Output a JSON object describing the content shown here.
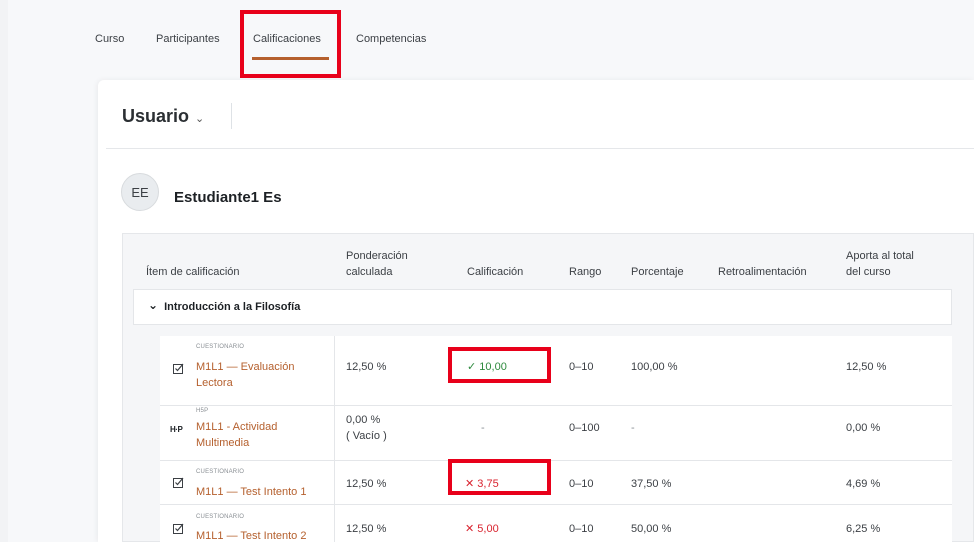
{
  "nav": {
    "tabs": [
      {
        "label": "Curso"
      },
      {
        "label": "Participantes"
      },
      {
        "label": "Calificaciones",
        "active": true
      },
      {
        "label": "Competencias"
      }
    ]
  },
  "header": {
    "user_selector": "Usuario",
    "chevron": "⌄"
  },
  "student": {
    "initials": "EE",
    "name": "Estudiante1 Es"
  },
  "table": {
    "columns": {
      "item": "Ítem de calificación",
      "weight_line1": "Ponderación",
      "weight_line2": "calculada",
      "grade": "Calificación",
      "range": "Rango",
      "percent": "Porcentaje",
      "feedback": "Retroalimentación",
      "contrib_line1": "Aporta al total",
      "contrib_line2": "del curso"
    },
    "category": {
      "name": "Introducción a la Filosofía",
      "chevron": "⌄"
    },
    "rows": [
      {
        "type": "CUESTIONARIO",
        "name_line1": "M1L1 — Evaluación",
        "name_line2": "Lectora",
        "weight": "12,50 %",
        "weight_line2": "",
        "grade_mark": "✓",
        "grade": "10,00",
        "range": "0–10",
        "percent": "100,00 %",
        "feedback": "",
        "contrib": "12,50 %"
      },
      {
        "type": "H5P",
        "name_line1": "M1L1 - Actividad",
        "name_line2": "Multimedia",
        "weight": "0,00 %",
        "weight_line2": "( Vacío )",
        "grade_mark": "",
        "grade": "-",
        "range": "0–100",
        "percent": "-",
        "feedback": "",
        "contrib": "0,00 %"
      },
      {
        "type": "CUESTIONARIO",
        "name_line1": "M1L1 — Test Intento 1",
        "name_line2": "",
        "weight": "12,50 %",
        "weight_line2": "",
        "grade_mark": "✕",
        "grade": "3,75",
        "range": "0–10",
        "percent": "37,50 %",
        "feedback": "",
        "contrib": "4,69 %"
      },
      {
        "type": "CUESTIONARIO",
        "name_line1": "M1L1 — Test Intento 2",
        "name_line2": "",
        "weight": "12,50 %",
        "weight_line2": "",
        "grade_mark": "✕",
        "grade": "5,00",
        "range": "0–10",
        "percent": "50,00 %",
        "feedback": "",
        "contrib": "6,25 %"
      }
    ]
  },
  "icons": {
    "quiz": "quiz-icon",
    "h5p": "H·P"
  },
  "colors": {
    "link": "#b5602e",
    "pass": "#2e8a3e",
    "fail": "#d9232f",
    "highlight": "#e8001a"
  }
}
